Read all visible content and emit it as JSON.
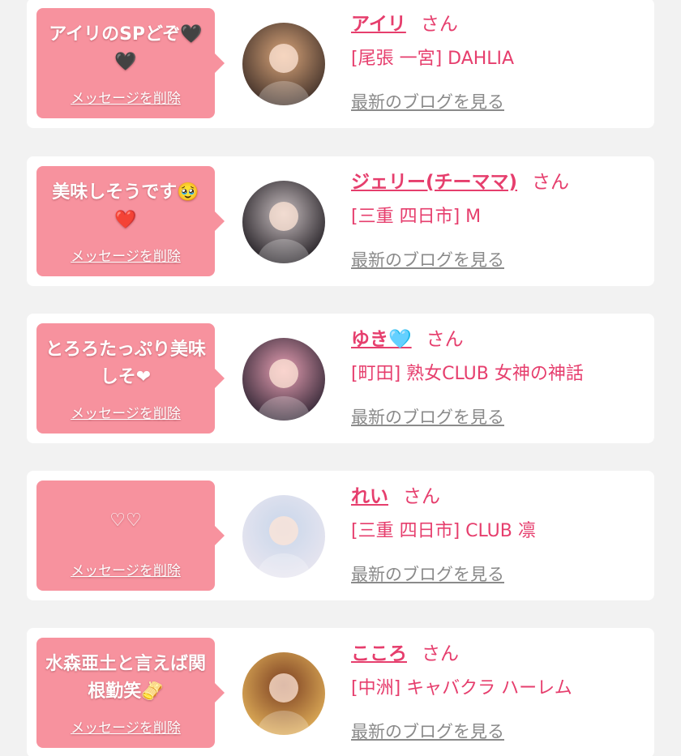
{
  "items": [
    {
      "message": "アイリのSPどぞ🖤🖤",
      "delete_label": "メッセージを削除",
      "name": "アイリ",
      "honorific": "さん",
      "shop": "[尾張 一宮] DAHLIA",
      "blog_label": "最新のブログを見る",
      "avatar_colors": [
        "#3b2c26",
        "#d9a57a"
      ]
    },
    {
      "message": "美味しそうです🥹❤️",
      "delete_label": "メッセージを削除",
      "name": "ジェリー(チーママ)",
      "honorific": "さん",
      "shop": "[三重 四日市] M",
      "blog_label": "最新のブログを見る",
      "avatar_colors": [
        "#1e1a1f",
        "#c9bfc1"
      ]
    },
    {
      "message": "とろろたっぷり美味しそ❤",
      "delete_label": "メッセージを削除",
      "name": "ゆき🩵",
      "honorific": "さん",
      "shop": "[町田] 熟女CLUB 女神の神話",
      "blog_label": "最新のブログを見る",
      "avatar_colors": [
        "#2b2230",
        "#e8a0b4"
      ]
    },
    {
      "message": "♡♡",
      "delete_label": "メッセージを削除",
      "name": "れい",
      "honorific": "さん",
      "shop": "[三重 四日市] CLUB 凛",
      "blog_label": "最新のブログを見る",
      "avatar_colors": [
        "#e9e6f0",
        "#c8d6ea"
      ]
    },
    {
      "message": "水森亜土と言えば関根勤笑🫔",
      "delete_label": "メッセージを削除",
      "name": "こころ",
      "honorific": "さん",
      "shop": "[中洲] キャバクラ ハーレム",
      "blog_label": "最新のブログを見る",
      "avatar_colors": [
        "#e3b25a",
        "#7a3e22"
      ]
    }
  ]
}
